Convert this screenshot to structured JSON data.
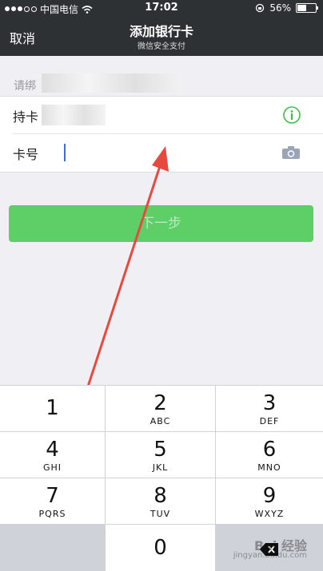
{
  "status": {
    "carrier": "中国电信",
    "time": "17:02",
    "battery": "56%",
    "battery_level": 0.56
  },
  "nav": {
    "cancel": "取消",
    "title": "添加银行卡",
    "subtitle": "微信安全支付"
  },
  "form": {
    "section_label": "请绑",
    "holder_label": "持卡",
    "card_label": "卡号"
  },
  "next_button": "下一步",
  "keypad": {
    "keys": [
      {
        "num": "1",
        "letters": ""
      },
      {
        "num": "2",
        "letters": "ABC"
      },
      {
        "num": "3",
        "letters": "DEF"
      },
      {
        "num": "4",
        "letters": "GHI"
      },
      {
        "num": "5",
        "letters": "JKL"
      },
      {
        "num": "6",
        "letters": "MNO"
      },
      {
        "num": "7",
        "letters": "PQRS"
      },
      {
        "num": "8",
        "letters": "TUV"
      },
      {
        "num": "9",
        "letters": "WXYZ"
      },
      {
        "num": "0",
        "letters": ""
      }
    ]
  },
  "watermark": {
    "main": "Bai 经验",
    "sub": "jingyan.baidu.com"
  },
  "colors": {
    "nav_bg": "#2e3133",
    "accent_green": "#5dcf66",
    "arrow_red": "#e8493f"
  }
}
